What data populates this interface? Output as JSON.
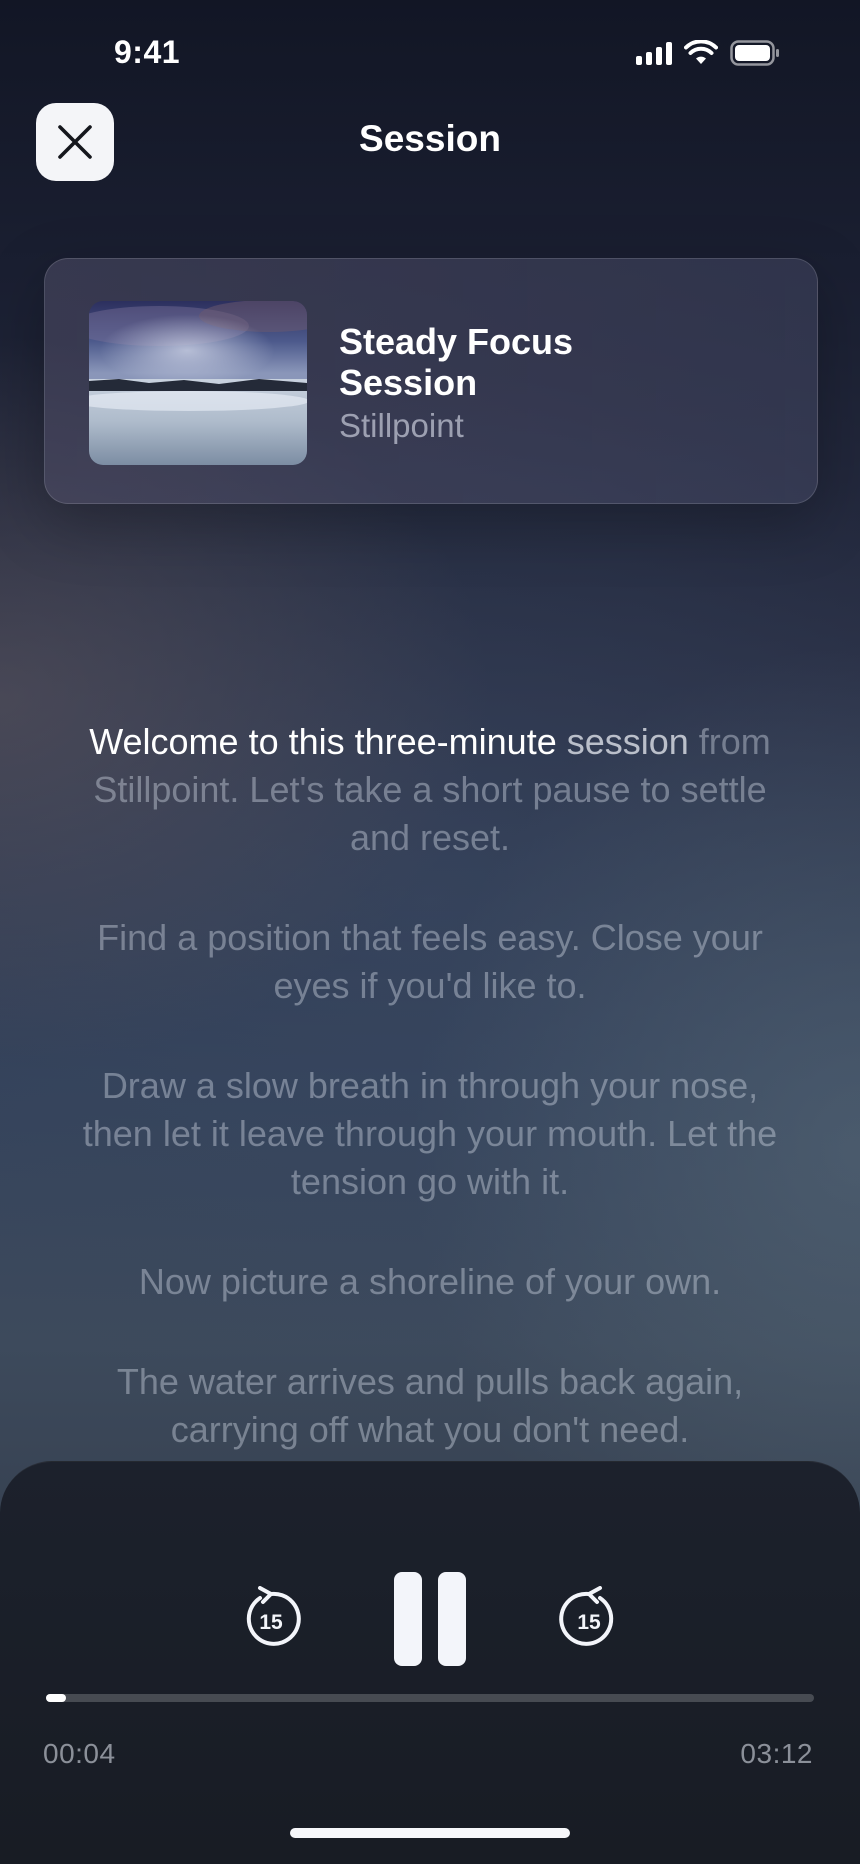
{
  "status_bar": {
    "time": "9:41"
  },
  "header": {
    "title": "Session"
  },
  "session_card": {
    "title": "Steady Focus Session",
    "subtitle": "Stillpoint"
  },
  "transcript": {
    "paragraphs": [
      {
        "active": "Welcome to this three-minute",
        "partial": " session",
        "rest": " from Stillpoint. Let's take a short pause to settle and reset."
      },
      {
        "text": "Find a position that feels easy. Close your eyes if you'd like to."
      },
      {
        "text": "Draw a slow breath in through your nose, then let it leave through your mouth. Let the tension go with it."
      },
      {
        "text": "Now picture a shoreline of your own."
      },
      {
        "text": "The water arrives and pulls back again, carrying off what you don't need."
      }
    ]
  },
  "player": {
    "rewind_label": "15",
    "forward_label": "15",
    "elapsed": "00:04",
    "total": "03:12",
    "progress_fraction": 0.021
  },
  "colors": {
    "accent": "#f4f5f8",
    "sheet": "#1b1f29"
  }
}
